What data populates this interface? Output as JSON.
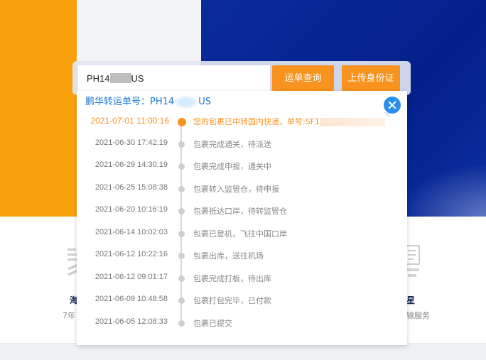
{
  "search": {
    "value_prefix": "PH14",
    "value_suffix": "US",
    "query_button": "运单查询",
    "upload_button": "上传身份证"
  },
  "panel": {
    "header_label": "鹏华转运单号：",
    "tracking_prefix": "PH14",
    "tracking_suffix": "US",
    "events": [
      {
        "time": "2021-07-01 11:00:16",
        "desc": "您的包裹已中转国内快递，单号:SF1",
        "highlight": true
      },
      {
        "time": "2021-06-30 17:42:19",
        "desc": "包裹完成通关，待派送"
      },
      {
        "time": "2021-06-29 14:30:19",
        "desc": "包裹完成申报，通关中"
      },
      {
        "time": "2021-06-25 15:08:38",
        "desc": "包裹转入监管仓，待申报"
      },
      {
        "time": "2021-06-20 10:16:19",
        "desc": "包裹抵达口岸，待转监管仓"
      },
      {
        "time": "2021-06-14 10:02:03",
        "desc": "包裹已登机，飞往中国口岸"
      },
      {
        "time": "2021-06-12 10:22:16",
        "desc": "包裹出库，送往机场"
      },
      {
        "time": "2021-06-12 09:01:17",
        "desc": "包裹完成打板，待出库"
      },
      {
        "time": "2021-06-09 10:48:58",
        "desc": "包裹打包完毕，已付款"
      },
      {
        "time": "2021-06-05 12:08:33",
        "desc": "包裹已提交"
      }
    ]
  },
  "background_features": {
    "left_title": "海",
    "left_desc": "7年",
    "right_title": "星",
    "right_desc": "输服务"
  },
  "colors": {
    "accent_orange": "#f7931e",
    "link_blue": "#1e78d2",
    "hero_blue": "#0a2b9c",
    "hero_orange": "#f9a20e"
  }
}
